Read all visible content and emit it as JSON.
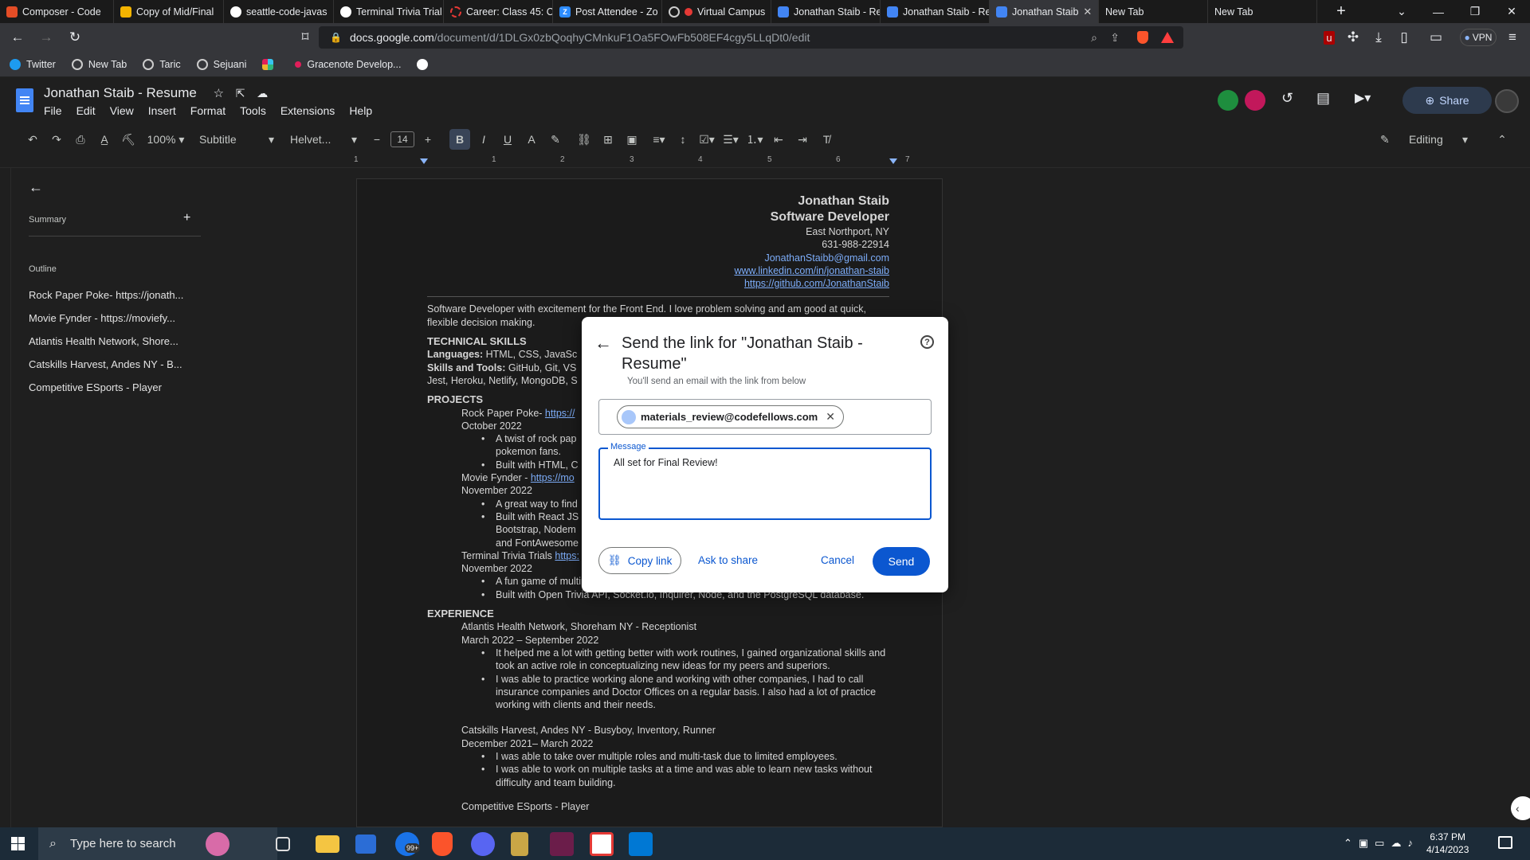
{
  "browser": {
    "tabs": [
      {
        "label": "Composer - Code",
        "color": "#e44d26",
        "active": false
      },
      {
        "label": "Copy of Mid/Final",
        "color": "#f4b400",
        "active": false
      },
      {
        "label": "seattle-code-javas",
        "color": "#ffffff",
        "active": false
      },
      {
        "label": "Terminal Trivia Trial",
        "color": "#ffffff",
        "active": false
      },
      {
        "label": "Career: Class 45: C",
        "color": "#e53935",
        "active": false
      },
      {
        "label": "Post Attendee - Zo",
        "color": "#2d8cff",
        "active": false
      },
      {
        "label": "Virtual Campus",
        "color": "#ffffff",
        "active": false
      },
      {
        "label": "Jonathan Staib - Re",
        "color": "#4285f4",
        "active": false
      },
      {
        "label": "Jonathan Staib - Re",
        "color": "#4285f4",
        "active": false
      },
      {
        "label": "Jonathan Staib",
        "color": "#4285f4",
        "active": true
      },
      {
        "label": "New Tab",
        "color": "",
        "active": false
      },
      {
        "label": "New Tab",
        "color": "",
        "active": false
      }
    ],
    "url_host": "docs.google.com",
    "url_path": "/document/d/1DLGx0zbQoqhyCMnkuF1Oa5FOwFb508EF4cgy5LLqDt0/edit",
    "vpn_label": "VPN",
    "bookmarks": [
      "Twitter",
      "New Tab",
      "Taric",
      "Sejuani",
      "",
      "Gracenote Develop...",
      ""
    ]
  },
  "docs": {
    "title": "Jonathan Staib - Resume",
    "menus": [
      "File",
      "Edit",
      "View",
      "Insert",
      "Format",
      "Tools",
      "Extensions",
      "Help"
    ],
    "share_label": "Share",
    "toolbar": {
      "zoom": "100%",
      "style": "Subtitle",
      "font": "Helvet...",
      "font_size": "14",
      "mode": "Editing"
    },
    "sidebar": {
      "summary_label": "Summary",
      "outline_label": "Outline",
      "outline_items": [
        "Rock Paper Poke- https://jonath...",
        "Movie Fynder - https://moviefy...",
        "Atlantis Health Network, Shore...",
        "Catskills Harvest, Andes NY - B...",
        "Competitive ESports - Player"
      ]
    },
    "ruler_numbers": [
      "1",
      "1",
      "2",
      "3",
      "4",
      "5",
      "6",
      "7"
    ]
  },
  "resume": {
    "name": "Jonathan Staib",
    "role": "Software Developer",
    "location": "East Northport, NY",
    "phone": "631-988-22914",
    "email": "JonathanStaibb@gmail.com",
    "linkedin": "www.linkedin.com/in/jonathan-staib",
    "github": "https://github.com/JonathanStaib",
    "intro": "Software Developer with excitement for the Front End. I love problem solving and am good at quick, flexible decision making.",
    "skills_heading": "TECHNICAL SKILLS",
    "languages_label": "Languages:",
    "languages": " HTML, CSS, JavaSc",
    "tools_label": "Skills and Tools:",
    "tools": " GitHub, Git, VS",
    "tools2": "Jest, Heroku, Netlify, MongoDB, S",
    "projects_heading": "PROJECTS",
    "p1_title": "Rock Paper Poke- ",
    "p1_link": "https://",
    "p1_date": "October 2022",
    "p1_b1": "A twist of rock pap",
    "p1_b1b": "pokemon fans.",
    "p1_b2": "Built with HTML, C",
    "p2_title": "Movie Fynder - ",
    "p2_link": "https://mo",
    "p2_date": "November 2022",
    "p2_b1": "A great way to find",
    "p2_b2": "Built with React JS",
    "p2_b2b": "Bootstrap, Nodem",
    "p2_b2c": "and FontAwesome",
    "p3_title": "Terminal Trivia Trials ",
    "p3_link": "https:",
    "p3_date": "November 2022",
    "p3_b1": "A fun game of multiplayer trivia inside of your terminal with your friends.",
    "p3_b2": "Built with Open Trivia API, Socket.io, Inquirer, Node, and the PostgreSQL database.",
    "experience_heading": "EXPERIENCE",
    "e1_title": "Atlantis Health Network, Shoreham NY - Receptionist",
    "e1_date": "March 2022 – September 2022",
    "e1_b1": "It helped me a lot with getting better with work routines, I gained organizational skills and took an active role in conceptualizing new ideas for my peers and superiors.",
    "e1_b2": "I was able to practice working alone and working with other companies, I had to call insurance companies and Doctor Offices on a regular basis. I also had a lot of practice working with clients and their needs.",
    "e2_title": "Catskills Harvest, Andes NY - Busyboy, Inventory, Runner",
    "e2_date": "December 2021– March 2022",
    "e2_b1": "I was able to take over multiple roles and multi-task due to limited employees.",
    "e2_b2": "I was able to work on multiple tasks at a time and was able to learn new tasks without difficulty and team building.",
    "e3_title": "Competitive ESports - Player"
  },
  "dialog": {
    "title": "Send the link for \"Jonathan Staib - Resume\"",
    "subtitle": "You'll send an email with the link from below",
    "recipient": "materials_review@codefellows.com",
    "message_label": "Message",
    "message": "All set for Final Review!",
    "copy_link": "Copy link",
    "ask_to_share": "Ask to share",
    "cancel": "Cancel",
    "send": "Send"
  },
  "taskbar": {
    "search_placeholder": "Type here to search",
    "time": "6:37 PM",
    "date": "4/14/2023",
    "mail_badge": "99+"
  }
}
